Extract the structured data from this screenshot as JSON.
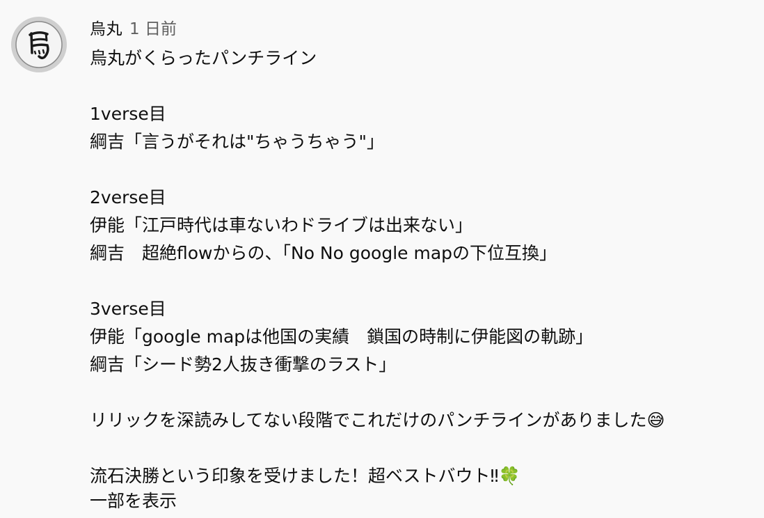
{
  "comment": {
    "author": "烏丸",
    "timestamp": "1 日前",
    "avatar_icon": "karasumaru-kanji-avatar-icon",
    "lines": [
      "烏丸がくらったパンチライン",
      "",
      "1verse目",
      "綱吉「言うがそれは\"ちゃうちゃう\"」",
      "",
      "2verse目",
      "伊能「江戸時代は車ないわドライブは出来ない」",
      "綱吉　超絶flowからの、「No No google mapの下位互換」",
      "",
      "3verse目",
      "伊能「google mapは他国の実績　鎖国の時制に伊能図の軌跡」",
      "綱吉「シード勢2人抜き衝撃のラスト」",
      "",
      "リリックを深読みしてない段階でこれだけのパンチラインがありました😅",
      "",
      "流石決勝という印象を受けました！超ベストバウト‼🍀"
    ],
    "show_more_label": "一部を表示"
  }
}
